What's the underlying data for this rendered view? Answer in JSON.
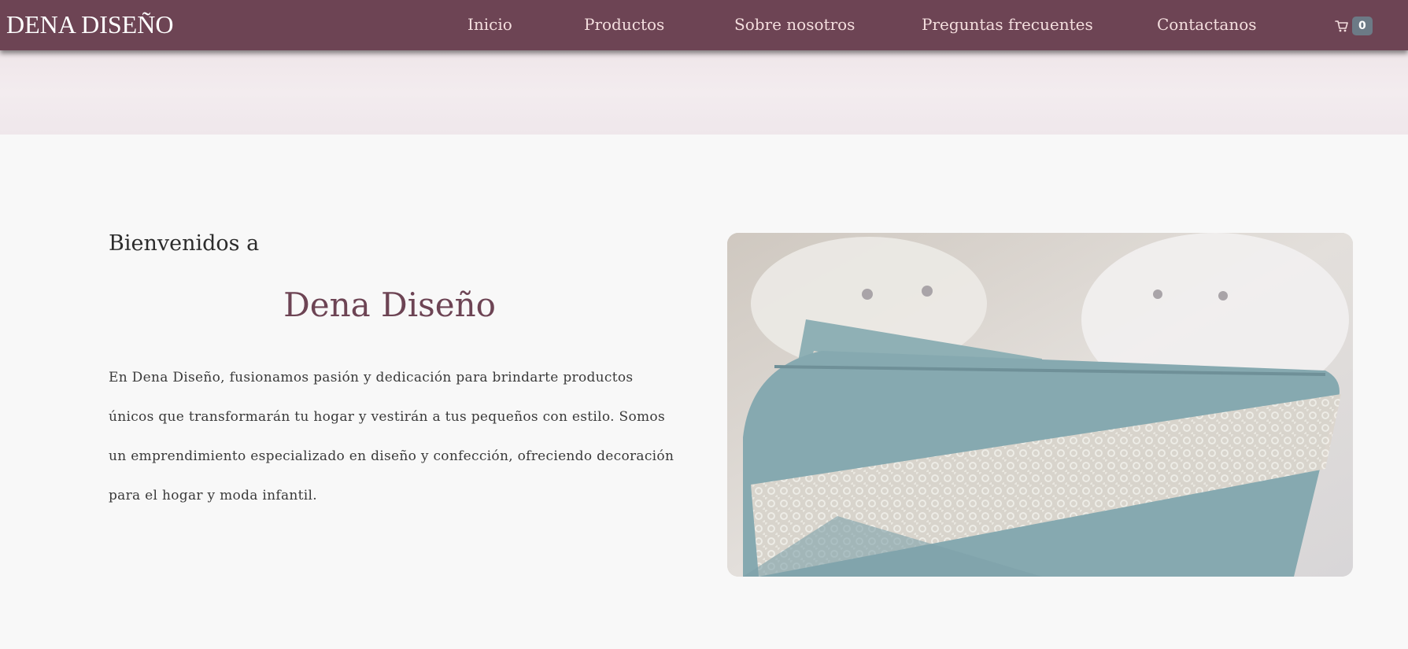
{
  "header": {
    "brand": "DENA DISEÑO",
    "nav": [
      {
        "label": "Inicio"
      },
      {
        "label": "Productos"
      },
      {
        "label": "Sobre nosotros"
      },
      {
        "label": "Preguntas frecuentes"
      },
      {
        "label": "Contactanos"
      }
    ],
    "cart": {
      "icon": "cart-icon",
      "count": "0"
    }
  },
  "main": {
    "welcome": "Bienvenidos a",
    "title": "Dena Diseño",
    "description": "En Dena Diseño, fusionamos pasión y dedicación para brindarte productos únicos que transformarán tu hogar y vestirán a tus pequeños con estilo. Somos un emprendimiento especializado en diseño y confección, ofreciendo decoración para el hogar y moda infantil."
  },
  "colors": {
    "navbar": "#6d4454",
    "accent": "#6d4454",
    "nav_text": "#f4dede",
    "badge": "#6c7a86",
    "background": "#f8f8f8"
  }
}
